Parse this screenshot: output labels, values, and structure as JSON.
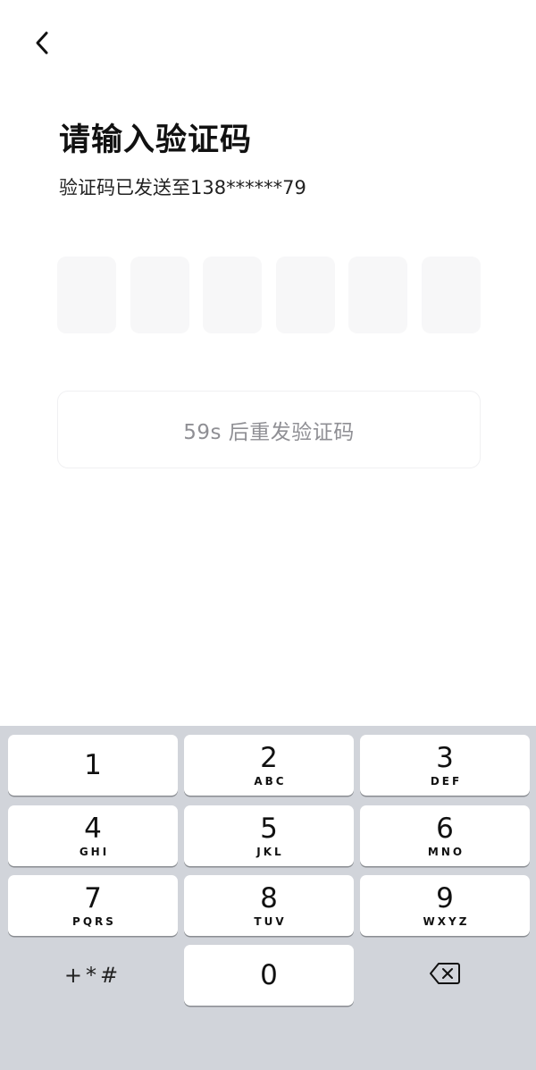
{
  "header": {
    "back_icon": "chevron-left-icon",
    "title": "请输入验证码",
    "subtitle": "验证码已发送至138******79"
  },
  "code_input": {
    "length": 6,
    "digits": [
      "",
      "",
      "",
      "",
      "",
      ""
    ]
  },
  "resend": {
    "label": "59s 后重发验证码"
  },
  "keypad": {
    "keys": [
      {
        "num": "1",
        "letters": ""
      },
      {
        "num": "2",
        "letters": "ABC"
      },
      {
        "num": "3",
        "letters": "DEF"
      },
      {
        "num": "4",
        "letters": "GHI"
      },
      {
        "num": "5",
        "letters": "JKL"
      },
      {
        "num": "6",
        "letters": "MNO"
      },
      {
        "num": "7",
        "letters": "PQRS"
      },
      {
        "num": "8",
        "letters": "TUV"
      },
      {
        "num": "9",
        "letters": "WXYZ"
      },
      {
        "num": "0",
        "letters": ""
      }
    ],
    "symbols_label": "+*#",
    "delete_icon": "backspace-icon"
  },
  "colors": {
    "keyboard_bg": "#d1d4da",
    "code_box_bg": "#f7f7f8",
    "resend_text": "#8f8f94"
  }
}
